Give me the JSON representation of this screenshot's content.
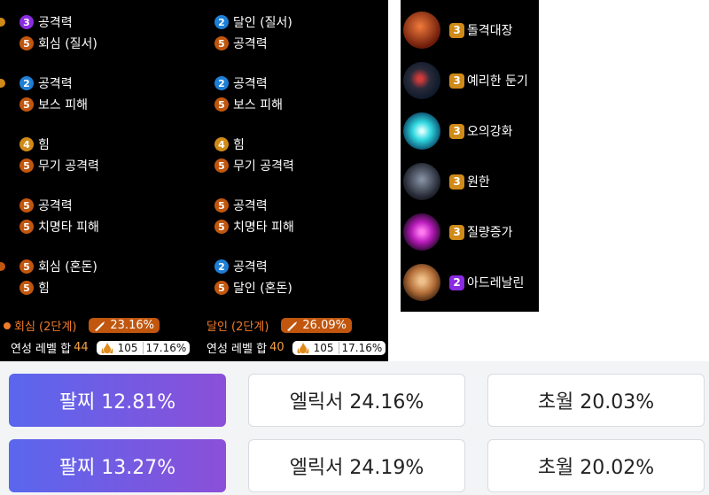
{
  "columns": [
    [
      {
        "lines": [
          {
            "level": "3",
            "color": "#8a2be2",
            "text": "공격력"
          },
          {
            "level": "5",
            "color": "#c1560e",
            "text": "회심 (질서)"
          }
        ]
      },
      {
        "lines": [
          {
            "level": "2",
            "color": "#1e7fd6",
            "text": "공격력"
          },
          {
            "level": "5",
            "color": "#c1560e",
            "text": "보스 피해"
          }
        ]
      },
      {
        "lines": [
          {
            "level": "4",
            "color": "#d08a18",
            "text": "힘"
          },
          {
            "level": "5",
            "color": "#c1560e",
            "text": "무기 공격력"
          }
        ]
      },
      {
        "lines": [
          {
            "level": "5",
            "color": "#c1560e",
            "text": "공격력"
          },
          {
            "level": "5",
            "color": "#c1560e",
            "text": "치명타 피해"
          }
        ]
      },
      {
        "lines": [
          {
            "level": "5",
            "color": "#c1560e",
            "text": "회심 (혼돈)"
          },
          {
            "level": "5",
            "color": "#c1560e",
            "text": "힘"
          }
        ]
      }
    ],
    [
      {
        "lines": [
          {
            "level": "2",
            "color": "#1e7fd6",
            "text": "달인 (질서)"
          },
          {
            "level": "5",
            "color": "#c1560e",
            "text": "공격력"
          }
        ]
      },
      {
        "lines": [
          {
            "level": "2",
            "color": "#1e7fd6",
            "text": "공격력"
          },
          {
            "level": "5",
            "color": "#c1560e",
            "text": "보스 피해"
          }
        ]
      },
      {
        "lines": [
          {
            "level": "4",
            "color": "#d08a18",
            "text": "힘"
          },
          {
            "level": "5",
            "color": "#c1560e",
            "text": "무기 공격력"
          }
        ]
      },
      {
        "lines": [
          {
            "level": "5",
            "color": "#c1560e",
            "text": "공격력"
          },
          {
            "level": "5",
            "color": "#c1560e",
            "text": "치명타 피해"
          }
        ]
      },
      {
        "lines": [
          {
            "level": "2",
            "color": "#1e7fd6",
            "text": "공격력"
          },
          {
            "level": "5",
            "color": "#c1560e",
            "text": "달인 (혼돈)"
          }
        ]
      }
    ]
  ],
  "summary": [
    {
      "name": "회심 (2단계)",
      "percent": "23.16%",
      "level_label": "연성 레벨 합",
      "level": "44",
      "count": "105",
      "count_pct": "17.16%"
    },
    {
      "name": "달인 (2단계)",
      "percent": "26.09%",
      "level_label": "연성 레벨 합",
      "level": "40",
      "count": "105",
      "count_pct": "17.16%"
    }
  ],
  "engravings": [
    {
      "level": "3",
      "color": "#d08a18",
      "name": "돌격대장",
      "icon": "charge-captain-icon",
      "tint": "#b5471c"
    },
    {
      "level": "3",
      "color": "#d08a18",
      "name": "예리한 둔기",
      "icon": "keen-blunt-icon",
      "tint": "#7a3a2a"
    },
    {
      "level": "3",
      "color": "#d08a18",
      "name": "오의강화",
      "icon": "esoteric-icon",
      "tint": "#1fb8c9"
    },
    {
      "level": "3",
      "color": "#d08a18",
      "name": "원한",
      "icon": "grudge-icon",
      "tint": "#4a5566"
    },
    {
      "level": "3",
      "color": "#d08a18",
      "name": "질량증가",
      "icon": "mass-increase-icon",
      "tint": "#c229b8"
    },
    {
      "level": "2",
      "color": "#8a2be2",
      "name": "아드레날린",
      "icon": "adrenaline-icon",
      "tint": "#c57a3a"
    }
  ],
  "results": [
    [
      "팔찌 12.81%",
      "엘릭서 24.16%",
      "초월 20.03%"
    ],
    [
      "팔찌 13.27%",
      "엘릭서 24.19%",
      "초월 20.02%"
    ]
  ]
}
